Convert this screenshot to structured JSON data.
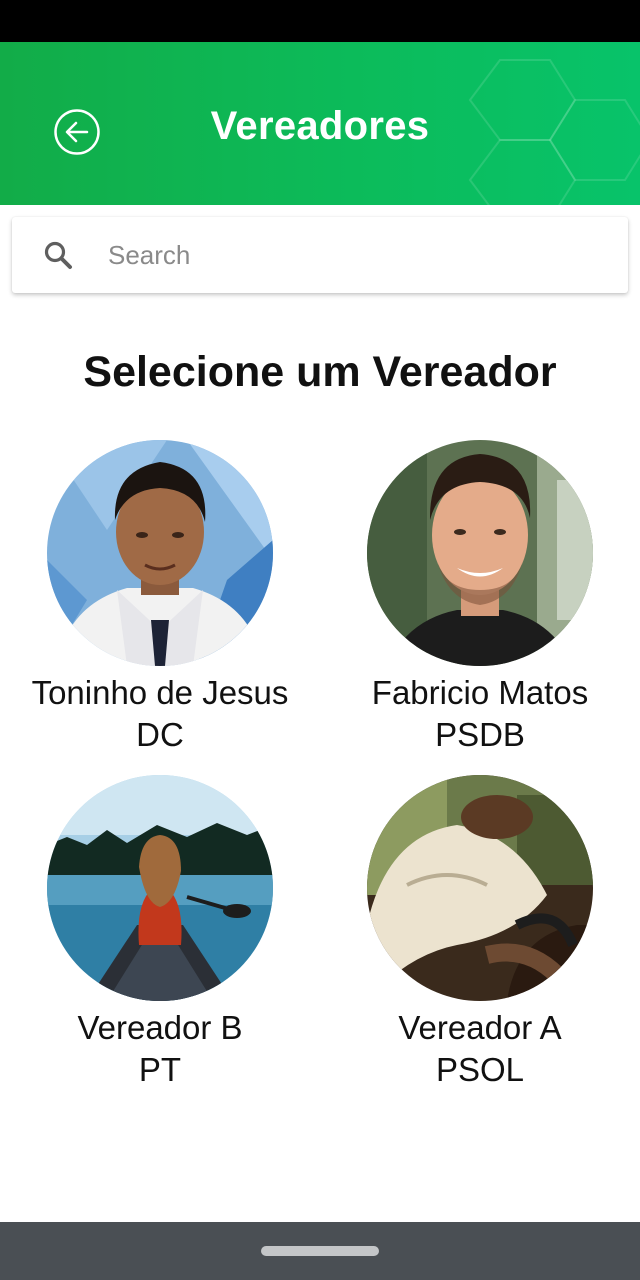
{
  "header": {
    "title": "Vereadores",
    "back_icon": "arrow-left-circle-icon",
    "accent_color": "#0cbb5a"
  },
  "search": {
    "placeholder": "Search",
    "value": "",
    "icon": "search-icon"
  },
  "section_title": "Selecione um Vereador",
  "councilors": [
    {
      "name": "Toninho de Jesus",
      "party": "DC"
    },
    {
      "name": "Fabricio Matos",
      "party": "PSDB"
    },
    {
      "name": "Vereador B",
      "party": "PT"
    },
    {
      "name": "Vereador A",
      "party": "PSOL"
    }
  ]
}
